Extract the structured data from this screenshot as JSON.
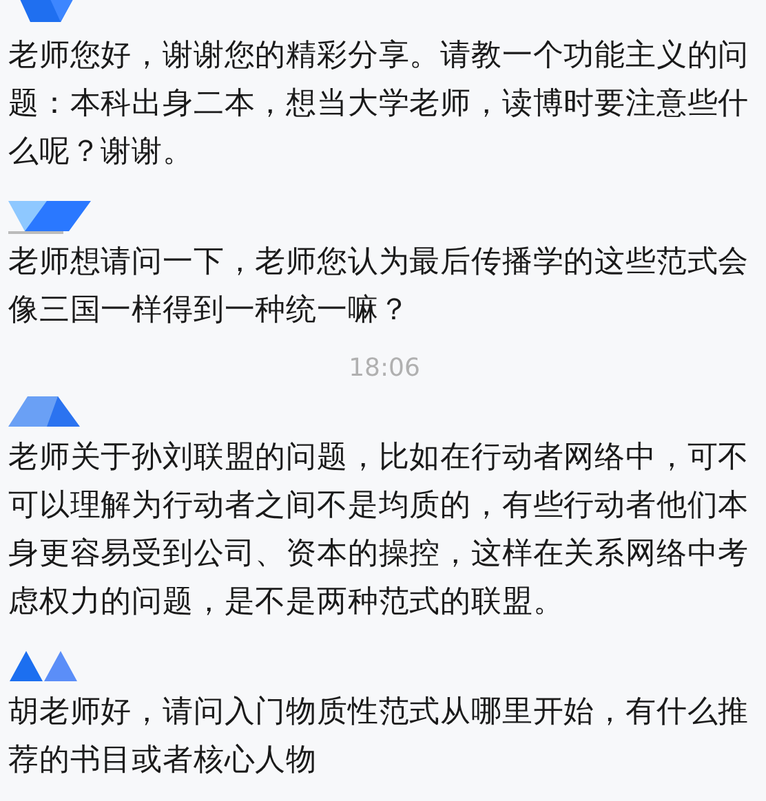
{
  "messages": [
    {
      "kind": "message",
      "text": "老师您好，谢谢您的精彩分享。请教一个功能主义的问题：本科出身二本，想当大学老师，读博时要注意些什么呢？谢谢。"
    },
    {
      "kind": "message",
      "text": "老师想请问一下，老师您认为最后传播学的这些范式会像三国一样得到一种统一嘛？"
    },
    {
      "kind": "time",
      "text": "18:06"
    },
    {
      "kind": "message",
      "text": "老师关于孙刘联盟的问题，比如在行动者网络中，可不可以理解为行动者之间不是均质的，有些行动者他们本身更容易受到公司、资本的操控，这样在关系网络中考虑权力的问题，是不是两种范式的联盟。"
    },
    {
      "kind": "message",
      "text": "胡老师好，请问入门物质性范式从哪里开始，有什么推荐的书目或者核心人物"
    }
  ]
}
